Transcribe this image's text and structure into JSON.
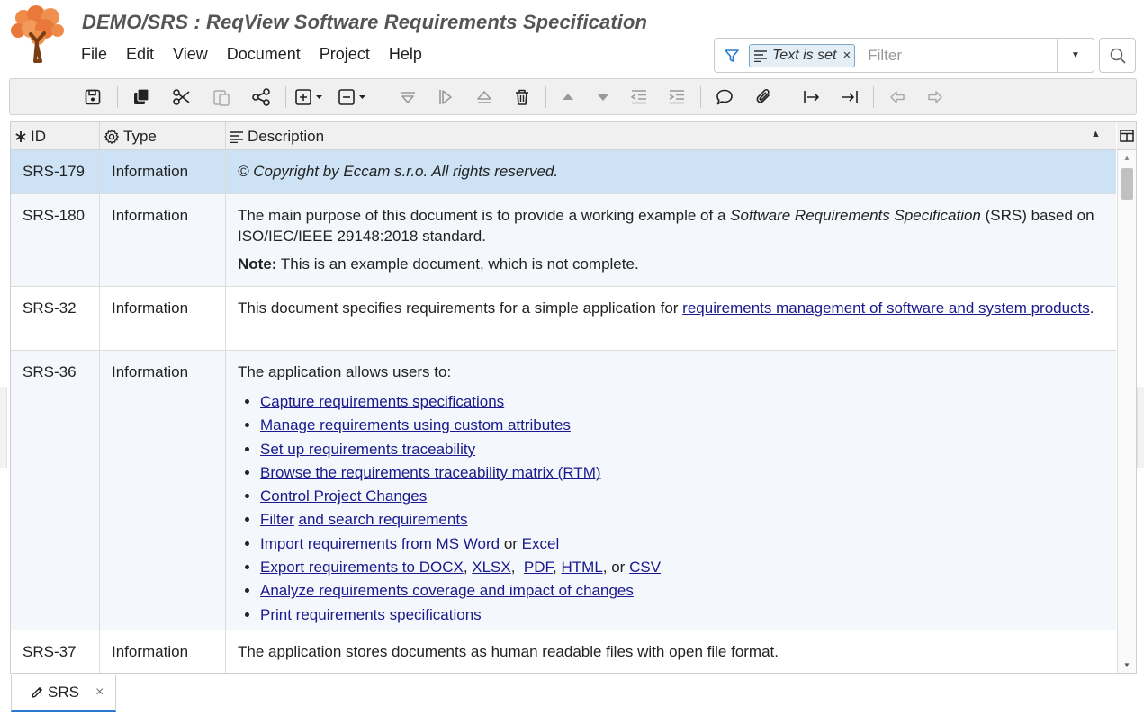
{
  "app": {
    "title": "DEMO/SRS : ReqView Software Requirements Specification"
  },
  "menu": {
    "items": [
      "File",
      "Edit",
      "View",
      "Document",
      "Project",
      "Help"
    ]
  },
  "filter": {
    "chip_label": "Text is set",
    "chip_close": "×",
    "placeholder": "Filter"
  },
  "toolbar": {
    "icons": [
      "save-icon",
      "copy-icon",
      "cut-icon",
      "paste-icon",
      "link-icon",
      "insert-icon",
      "delete-section-icon",
      "filter-down-icon",
      "play-icon",
      "eject-icon",
      "trash-icon",
      "move-up-icon",
      "move-down-icon",
      "outdent-icon",
      "indent-icon",
      "comment-icon",
      "attachment-icon",
      "trace-out-icon",
      "trace-end-icon",
      "back-icon",
      "forward-icon"
    ]
  },
  "grid": {
    "columns": [
      "ID",
      "Type",
      "Description"
    ],
    "rows": [
      {
        "id": "SRS-179",
        "type": "Information",
        "desc_italic": "© Copyright by Eccam s.r.o. All rights reserved."
      },
      {
        "id": "SRS-180",
        "type": "Information",
        "desc_pre": "The main purpose of this document is to provide a working example of a ",
        "desc_em": "Software Requirements Specification",
        "desc_post": " (SRS) based on ISO/IEC/IEEE 29148:2018 standard.",
        "note_label": "Note:",
        "note_text": " This is an example document, which is not complete."
      },
      {
        "id": "SRS-32",
        "type": "Information",
        "desc_pre": "This document specifies requirements for a simple application for ",
        "desc_link": "requirements management of software and system products",
        "desc_post": "."
      },
      {
        "id": "SRS-36",
        "type": "Information",
        "intro": "The application allows users to:",
        "bullets": {
          "b1": "Capture requirements specifications",
          "b2": "Manage requirements using custom attributes",
          "b3": "Set up requirements traceability",
          "b4": "Browse the requirements traceability matrix (RTM)",
          "b5": "Control Project Changes",
          "b6a": "Filter",
          "b6b": " ",
          "b6c": "and search requirements",
          "b7a": "Import requirements from MS Word",
          "b7b": " or ",
          "b7c": "Excel",
          "b8a": "Export requirements to DOCX",
          "b8b": ", ",
          "b8c": "XLSX",
          "b8d": ",  ",
          "b8e": "PDF",
          "b8f": ", ",
          "b8g": "HTML",
          "b8h": ", or ",
          "b8i": "CSV",
          "b9": "Analyze requirements coverage and impact of changes",
          "b10": "Print requirements specifications"
        }
      },
      {
        "id": "SRS-37",
        "type": "Information",
        "desc": "The application stores documents as human readable files with open file format."
      }
    ]
  },
  "tabs": {
    "doc_tab": "SRS",
    "doc_tab_close": "×"
  },
  "colors": {
    "selected_row": "#cde3f5",
    "link": "#1a1a8c",
    "tab_underline": "#2a7bd0",
    "logo_tree": "#e8793a"
  }
}
